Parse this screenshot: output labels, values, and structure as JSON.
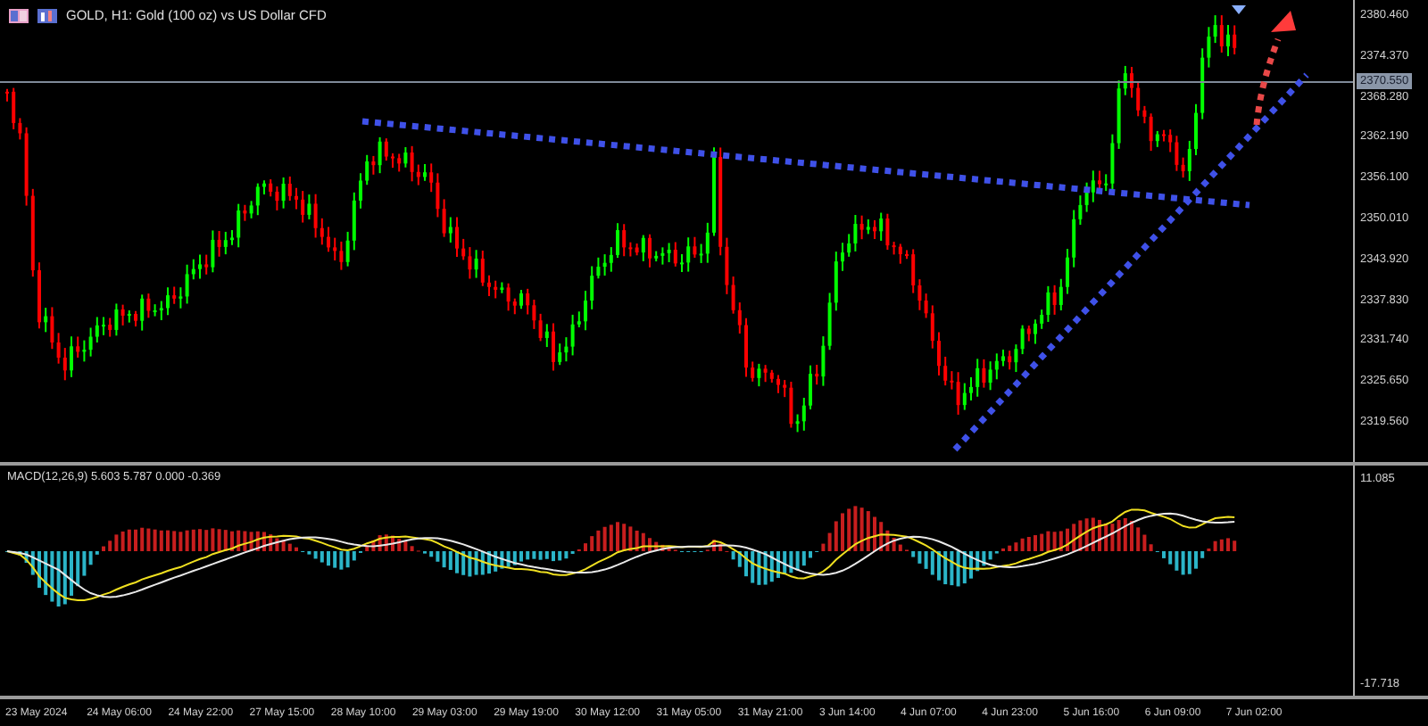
{
  "window": {
    "title": "GOLD, H1:  Gold (100 oz) vs US Dollar CFD"
  },
  "price_axis": {
    "labels": [
      "2380.460",
      "2374.370",
      "2368.280",
      "2362.190",
      "2356.100",
      "2350.010",
      "2343.920",
      "2337.830",
      "2331.740",
      "2325.650",
      "2319.560"
    ],
    "current_price": "2370.550"
  },
  "macd": {
    "label": "MACD(12,26,9) 5.603 5.787 0.000 -0.369",
    "axis_labels": [
      "11.085",
      "-17.718"
    ]
  },
  "time_axis": {
    "labels": [
      "23 May 2024",
      "24 May 06:00",
      "24 May 22:00",
      "27 May 15:00",
      "28 May 10:00",
      "29 May 03:00",
      "29 May 19:00",
      "30 May 12:00",
      "31 May 05:00",
      "31 May 21:00",
      "3 Jun 14:00",
      "4 Jun 07:00",
      "4 Jun 23:00",
      "5 Jun 16:00",
      "6 Jun 09:00",
      "7 Jun 02:00"
    ]
  }
}
